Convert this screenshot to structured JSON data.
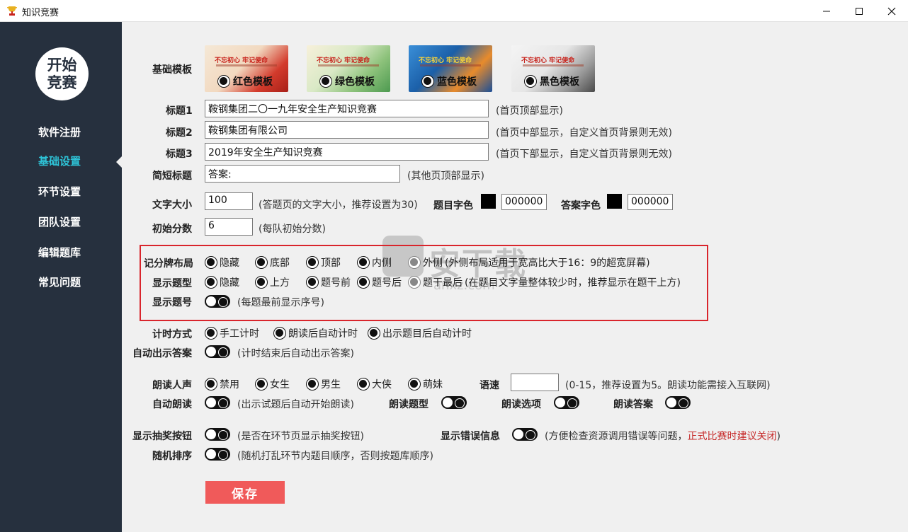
{
  "window": {
    "title": "知识竞赛"
  },
  "sidebar": {
    "logo": "开始竞赛",
    "items": [
      {
        "label": "软件注册"
      },
      {
        "label": "基础设置",
        "active": true
      },
      {
        "label": "环节设置"
      },
      {
        "label": "团队设置"
      },
      {
        "label": "编辑题库"
      },
      {
        "label": "常见问题"
      }
    ]
  },
  "template": {
    "label": "基础模板",
    "thumb_heading": "不忘初心 牢记使命",
    "options": [
      {
        "label": "红色模板",
        "color": "#d33b2c"
      },
      {
        "label": "绿色模板",
        "color": "#4d9a50"
      },
      {
        "label": "蓝色模板",
        "color": "#1b5fa8"
      },
      {
        "label": "黑色模板",
        "color": "#4a4a4a"
      }
    ]
  },
  "titles": {
    "title1": {
      "label": "标题1",
      "value": "鞍钢集团二〇一九年安全生产知识竞赛",
      "hint": "(首页顶部显示)"
    },
    "title2": {
      "label": "标题2",
      "value": "鞍钢集团有限公司",
      "hint": "(首页中部显示，自定义首页背景则无效)"
    },
    "title3": {
      "label": "标题3",
      "value": "2019年安全生产知识竞赛",
      "hint": "(首页下部显示，自定义首页背景则无效)"
    },
    "short": {
      "label": "简短标题",
      "value": "答案:",
      "hint": "(其他页顶部显示)"
    }
  },
  "text_size": {
    "label": "文字大小",
    "value": "100",
    "hint": "(答题页的文字大小，推荐设置为30)"
  },
  "question_color": {
    "label": "题目字色",
    "value": "000000",
    "swatch": "#000000"
  },
  "answer_color": {
    "label": "答案字色",
    "value": "000000",
    "swatch": "#000000"
  },
  "initial_score": {
    "label": "初始分数",
    "value": "6",
    "hint": "(每队初始分数)"
  },
  "scoreboard": {
    "label": "记分牌布局",
    "options": [
      "隐藏",
      "底部",
      "顶部",
      "内侧",
      "外侧"
    ],
    "hint": "(外侧布局适用于宽高比大于16：9的超宽屏幕)"
  },
  "question_type": {
    "label": "显示题型",
    "options": [
      "隐藏",
      "上方",
      "题号前",
      "题号后",
      "题干最后"
    ],
    "hint": "(在题目文字量整体较少时，推荐显示在题干上方)"
  },
  "question_number": {
    "label": "显示题号",
    "hint": "(每题最前显示序号)"
  },
  "timer": {
    "label": "计时方式",
    "options": [
      "手工计时",
      "朗读后自动计时",
      "出示题目后自动计时"
    ]
  },
  "auto_answer": {
    "label": "自动出示答案",
    "hint": "(计时结束后自动出示答案)"
  },
  "voice": {
    "label": "朗读人声",
    "options": [
      "禁用",
      "女生",
      "男生",
      "大侠",
      "萌妹"
    ],
    "speed_label": "语速",
    "speed_value": "",
    "speed_hint": "(0-15，推荐设置为5。朗读功能需接入互联网)"
  },
  "auto_read": {
    "label": "自动朗读",
    "hint": "(出示试题后自动开始朗读)",
    "read_type_label": "朗读题型",
    "read_options_label": "朗读选项",
    "read_answer_label": "朗读答案"
  },
  "lottery": {
    "label": "显示抽奖按钮",
    "hint": "(是否在环节页显示抽奖按钮)"
  },
  "errors": {
    "label": "显示错误信息",
    "hint": "(方便检查资源调用错误等问题，",
    "warning": "正式比赛时建议关闭",
    "hint_end": ")",
    "warning_color": "#c62828"
  },
  "shuffle": {
    "label": "随机排序",
    "hint": "(随机打乱环节内题目顺序，否则按题库顺序)"
  },
  "save_label": "保存",
  "watermark": {
    "text": "安下载",
    "url": "anxz.com"
  },
  "colors": {
    "sidebar": "#26303e",
    "accent": "#2ec4d8",
    "save": "#f05a5a",
    "highlight_box": "#d9252c"
  }
}
